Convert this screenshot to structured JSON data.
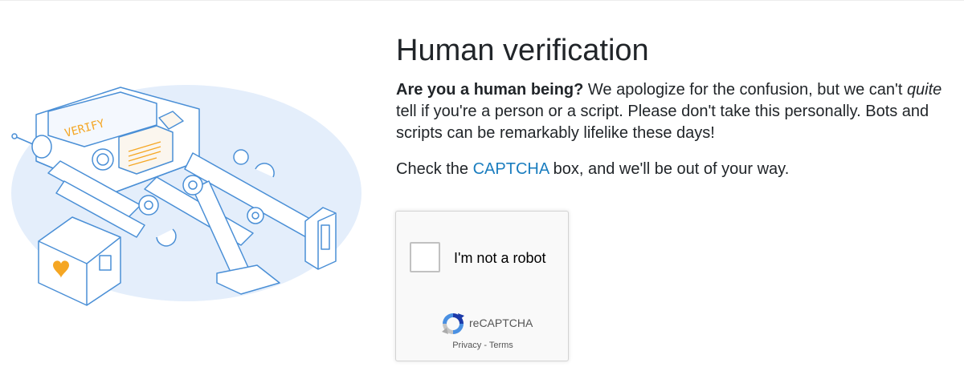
{
  "heading": "Human verification",
  "intro": {
    "bold": "Are you a human being?",
    "text_before_italic": " We apologize for the confusion, but we can't ",
    "italic": "quite",
    "text_after_italic": " tell if you're a person or a script. Please don't take this personally. Bots and scripts can be remarkably lifelike these days!"
  },
  "instruction": {
    "before": "Check the ",
    "link": "CAPTCHA",
    "after": " box, and we'll be out of your way."
  },
  "captcha": {
    "label": "I'm not a robot",
    "brand": "reCAPTCHA",
    "privacy": "Privacy",
    "separator": " - ",
    "terms": "Terms"
  },
  "illustration": {
    "screen_text": "VERIFY",
    "accent_color": "#f5a623",
    "background_blob_color": "#e4eefb",
    "line_color": "#4a8fd6"
  },
  "colors": {
    "link": "#1a7dbf",
    "heading": "#212529"
  }
}
